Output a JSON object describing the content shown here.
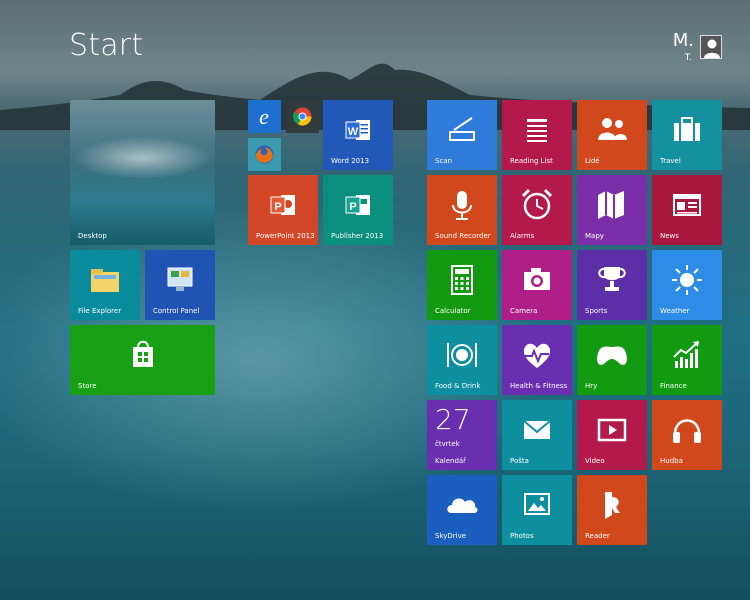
{
  "screen": {
    "title": "Start"
  },
  "user": {
    "name": "M.",
    "sub": "T."
  },
  "tiles": {
    "desktop": "Desktop",
    "file_explorer": "File Explorer",
    "control_panel": "Control Panel",
    "store": "Store",
    "word": "Word 2013",
    "powerpoint": "PowerPoint 2013",
    "publisher": "Publisher 2013",
    "scan": "Scan",
    "reading_list": "Reading List",
    "lide": "Lidé",
    "travel": "Travel",
    "sound_recorder": "Sound Recorder",
    "alarms": "Alarms",
    "mapy": "Mapy",
    "news": "News",
    "calculator": "Calculator",
    "camera": "Camera",
    "sports": "Sports",
    "weather": "Weather",
    "food": "Food & Drink",
    "health": "Health & Fitness",
    "hry": "Hry",
    "finance": "Finance",
    "kalendar": "Kalendář",
    "kalendar_day": "27",
    "kalendar_weekday": "čtvrtek",
    "posta": "Pošta",
    "video": "Video",
    "hudba": "Hudba",
    "skydrive": "SkyDrive",
    "photos": "Photos",
    "reader": "Reader"
  },
  "icons": {
    "ie": "internet-explorer-icon",
    "chrome": "chrome-icon",
    "firefox": "firefox-icon"
  }
}
